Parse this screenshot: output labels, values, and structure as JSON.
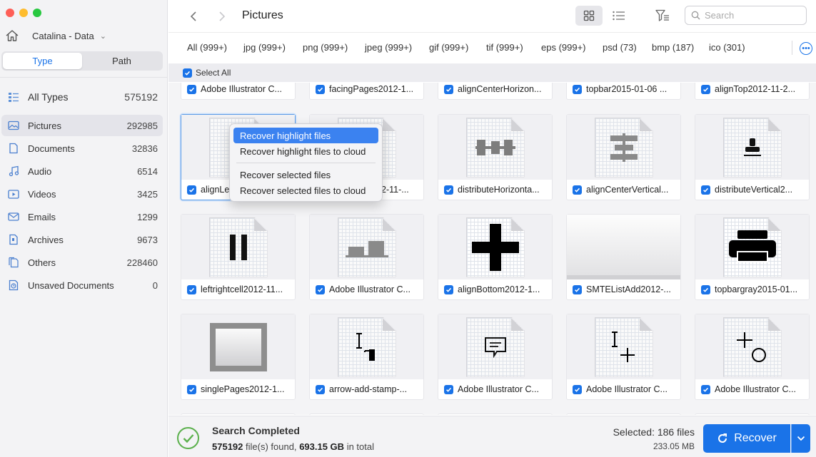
{
  "drive": {
    "name": "Catalina - Data"
  },
  "mode_tabs": [
    {
      "label": "Type"
    },
    {
      "label": "Path"
    }
  ],
  "categories": [
    {
      "label": "All Types",
      "count": "575192",
      "icon": "list-icon"
    },
    {
      "label": "Pictures",
      "count": "292985",
      "icon": "image-icon"
    },
    {
      "label": "Documents",
      "count": "32836",
      "icon": "document-icon"
    },
    {
      "label": "Audio",
      "count": "6514",
      "icon": "music-icon"
    },
    {
      "label": "Videos",
      "count": "3425",
      "icon": "video-icon"
    },
    {
      "label": "Emails",
      "count": "1299",
      "icon": "mail-icon"
    },
    {
      "label": "Archives",
      "count": "9673",
      "icon": "archive-icon"
    },
    {
      "label": "Others",
      "count": "228460",
      "icon": "others-icon"
    },
    {
      "label": "Unsaved Documents",
      "count": "0",
      "icon": "unsaved-icon"
    }
  ],
  "toolbar": {
    "title": "Pictures",
    "search_placeholder": "Search"
  },
  "filters": [
    "All (999+)",
    "jpg (999+)",
    "png (999+)",
    "jpeg (999+)",
    "gif (999+)",
    "tif (999+)",
    "eps (999+)",
    "psd (73)",
    "bmp (187)",
    "ico (301)"
  ],
  "select_all": "Select All",
  "files": [
    "Adobe Illustrator C...",
    "facingPages2012-1...",
    "alignCenterHorizon...",
    "topbar2015-01-06 ...",
    "alignTop2012-11-2...",
    "alignLef",
    "2-11-...",
    "distributeHorizonta...",
    "alignCenterVertical...",
    "distributeVertical2...",
    "leftrightcell2012-11...",
    "Adobe Illustrator C...",
    "alignBottom2012-1...",
    "SMTEListAdd2012-...",
    "topbargray2015-01...",
    "singlePages2012-1...",
    "arrow-add-stamp-...",
    "Adobe Illustrator C...",
    "Adobe Illustrator C...",
    "Adobe Illustrator C..."
  ],
  "context_menu": [
    "Recover highlight files",
    "Recover highlight files to cloud",
    "Recover selected files",
    "Recover selected files to cloud"
  ],
  "status": {
    "title": "Search Completed",
    "files_found": "575192",
    "files_found_suffix": "file(s) found,",
    "total_size": "693.15 GB",
    "total_suffix": "in total",
    "selected": "Selected: 186 files",
    "selected_size": "233.05 MB",
    "recover_label": "Recover"
  },
  "colors": {
    "accent": "#1a73e8",
    "success": "#5bb04c"
  }
}
